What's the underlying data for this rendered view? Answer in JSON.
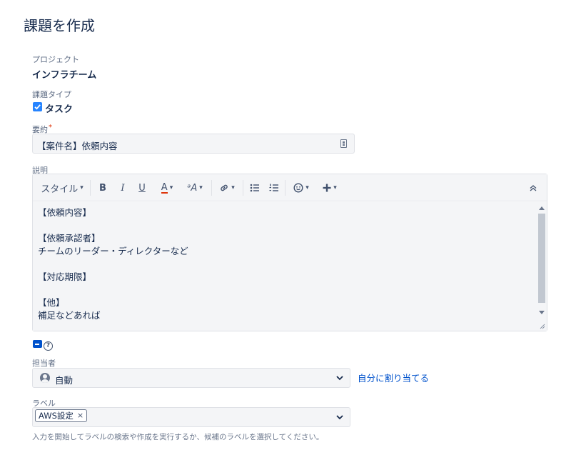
{
  "page": {
    "title": "課題を作成"
  },
  "project": {
    "label": "プロジェクト",
    "value": "インフラチーム"
  },
  "issue_type": {
    "label": "課題タイプ",
    "value": "タスク"
  },
  "summary": {
    "label": "要約",
    "required_mark": "*",
    "value": "【案件名】依頼内容"
  },
  "description": {
    "label": "説明",
    "toolbar": {
      "style_label": "スタイル",
      "bold": "B",
      "italic": "I",
      "underline": "U",
      "text_color": "A",
      "more_formatting": "ᵃA"
    },
    "lines": [
      "【依頼内容】",
      "",
      "【依頼承認者】",
      "チームのリーダー・ディレクターなど",
      "",
      "【対応期限】",
      "",
      "【他】",
      "補足などあれば"
    ]
  },
  "assignee": {
    "label": "担当者",
    "value": "自動",
    "assign_me_link": "自分に割り当てる"
  },
  "labels": {
    "label": "ラベル",
    "tags": [
      "AWS設定"
    ],
    "remove_symbol": "×",
    "help_text": "入力を開始してラベルの検索や作成を実行するか、候補のラベルを選択してください。"
  },
  "colors": {
    "accent": "#0052cc",
    "required": "#de350b",
    "text_color_underline": "#de350b",
    "checkbox": "#2684ff"
  },
  "icons": [
    "checkbox-icon",
    "field-info-icon",
    "chevron-down-icon",
    "bold-icon",
    "italic-icon",
    "underline-icon",
    "text-color-icon",
    "link-icon",
    "bullet-list-icon",
    "numbered-list-icon",
    "emoji-icon",
    "plus-icon",
    "collapse-icon",
    "markdown-icon",
    "help-icon",
    "avatar-icon"
  ]
}
